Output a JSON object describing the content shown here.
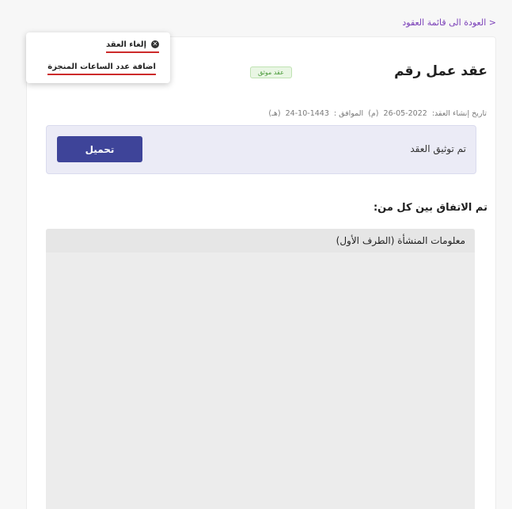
{
  "back_link": "< العودة الى قائمة العقود",
  "contract": {
    "title": "عقد عمل رقم",
    "status_badge": "عقد موثق",
    "creation_label": "تاريخ إنشاء العقد:",
    "creation_date": "2022-05-26",
    "gregorian_marker": "(م)",
    "corresponding_label": "الموافق :",
    "hijri_date": "1443-10-24",
    "hijri_marker": "(هـ)"
  },
  "documentation": {
    "text": "تم توثيق العقد",
    "download_label": "تحميل"
  },
  "agreement_heading": "تم الاتفاق بين كل من:",
  "establishment_panel": {
    "title": "معلومات المنشأة (الطرف الأول)"
  },
  "menu": {
    "cancel_label": "إلغاء العقد",
    "add_hours_label": "اضافة عدد الساعات المنجزة"
  },
  "colors": {
    "accent": "#3e4499",
    "link": "#7a3fb8",
    "underline": "#cc2a2a",
    "badge": "#4a9a3a"
  }
}
